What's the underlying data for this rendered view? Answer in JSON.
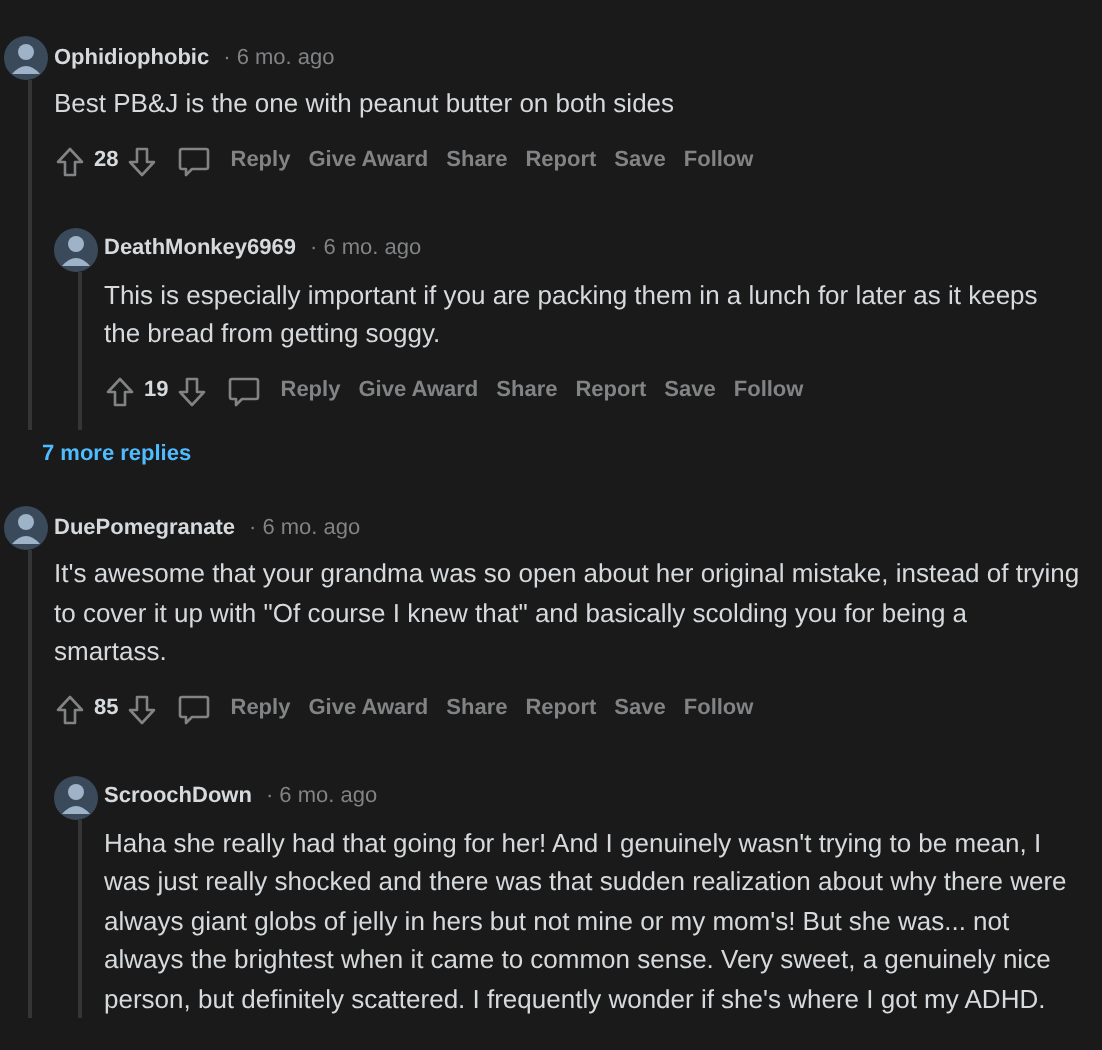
{
  "comments": [
    {
      "author": "Ophidiophobic",
      "time": "· 6 mo. ago",
      "body": "Best PB&J is the one with peanut butter on both sides",
      "votes": "28",
      "actions": [
        "Reply",
        "Give Award",
        "Share",
        "Report",
        "Save",
        "Follow"
      ],
      "children": [
        {
          "author": "DeathMonkey6969",
          "time": "· 6 mo. ago",
          "body": "This is especially important if you are packing them in a lunch for later as it keeps the bread from getting soggy.",
          "votes": "19",
          "actions": [
            "Reply",
            "Give Award",
            "Share",
            "Report",
            "Save",
            "Follow"
          ]
        }
      ],
      "more": "7 more replies"
    },
    {
      "author": "DuePomegranate",
      "time": "· 6 mo. ago",
      "body": "It's awesome that your grandma was so open about her original mistake, instead of trying to cover it up with \"Of course I knew that\" and basically scolding you for being a smartass.",
      "votes": "85",
      "actions": [
        "Reply",
        "Give Award",
        "Share",
        "Report",
        "Save",
        "Follow"
      ],
      "children": [
        {
          "author": "ScroochDown",
          "time": "· 6 mo. ago",
          "body": "Haha she really had that going for her! And I genuinely wasn't trying to be mean, I was just really shocked and there was that sudden realization about why there were always giant globs of jelly in hers but not mine or my mom's! But she was... not always the brightest when it came to common sense. Very sweet, a genuinely nice person, but definitely scattered. I frequently wonder if she's where I got my ADHD."
        }
      ]
    }
  ]
}
